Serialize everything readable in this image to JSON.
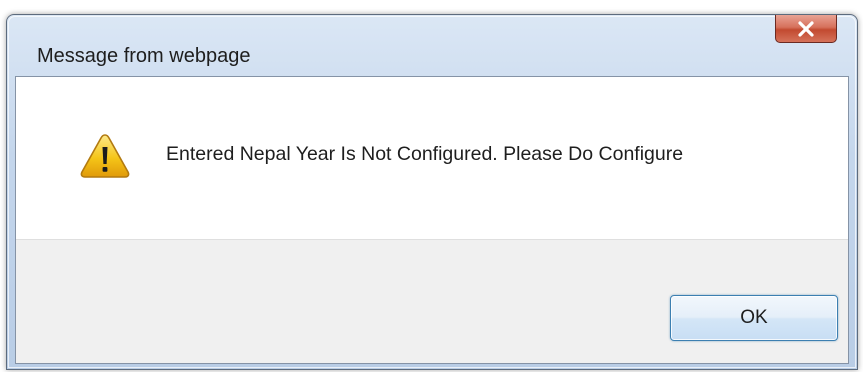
{
  "dialog": {
    "title": "Message from webpage",
    "message": "Entered Nepal Year Is Not Configured. Please Do Configure",
    "icon": "warning-icon",
    "close_icon": "close-icon",
    "ok_label": "OK"
  },
  "colors": {
    "close_button": "#c24a30",
    "ok_border": "#3c7fb1",
    "button_area_bg": "#f0f0f0",
    "warning_fill": "#f5c518"
  }
}
